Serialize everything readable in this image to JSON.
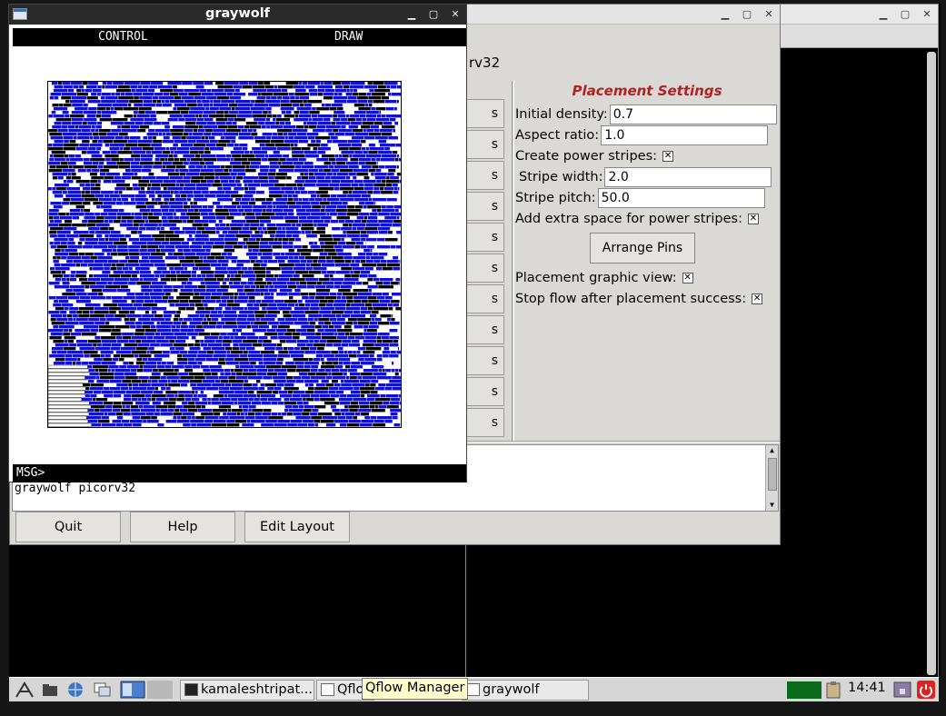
{
  "qflow": {
    "project_label": "rv32",
    "step_button_text": "s",
    "step_count": 11,
    "settings": {
      "heading": "Placement Settings",
      "initial_density_label": "Initial density:",
      "initial_density_value": "0.7",
      "aspect_ratio_label": "Aspect ratio:",
      "aspect_ratio_value": "1.0",
      "create_power_stripes_label": "Create power stripes:",
      "create_power_stripes_checked": true,
      "stripe_width_label": "Stripe width:",
      "stripe_width_value": "2.0",
      "stripe_pitch_label": "Stripe pitch:",
      "stripe_pitch_value": "50.0",
      "extra_space_label": "Add extra space for power stripes:",
      "extra_space_checked": true,
      "arrange_pins_label": "Arrange Pins",
      "graphic_view_label": "Placement graphic view:",
      "graphic_view_checked": true,
      "stop_flow_label": "Stop flow after placement success:",
      "stop_flow_checked": true
    },
    "console_text": "graywolf  picorv32",
    "buttons": {
      "quit": "Quit",
      "help": "Help",
      "edit_layout": "Edit Layout"
    }
  },
  "graywolf": {
    "title": "graywolf",
    "menu_control": "CONTROL",
    "menu_draw": "DRAW",
    "msg_prompt": "MSG>",
    "fill_color": "#1010d0"
  },
  "taskbar": {
    "tasks": [
      "kamaleshtripat...",
      "Qflo",
      "graywolf"
    ],
    "tooltip": "Qflow Manager",
    "clock": "14:41"
  }
}
